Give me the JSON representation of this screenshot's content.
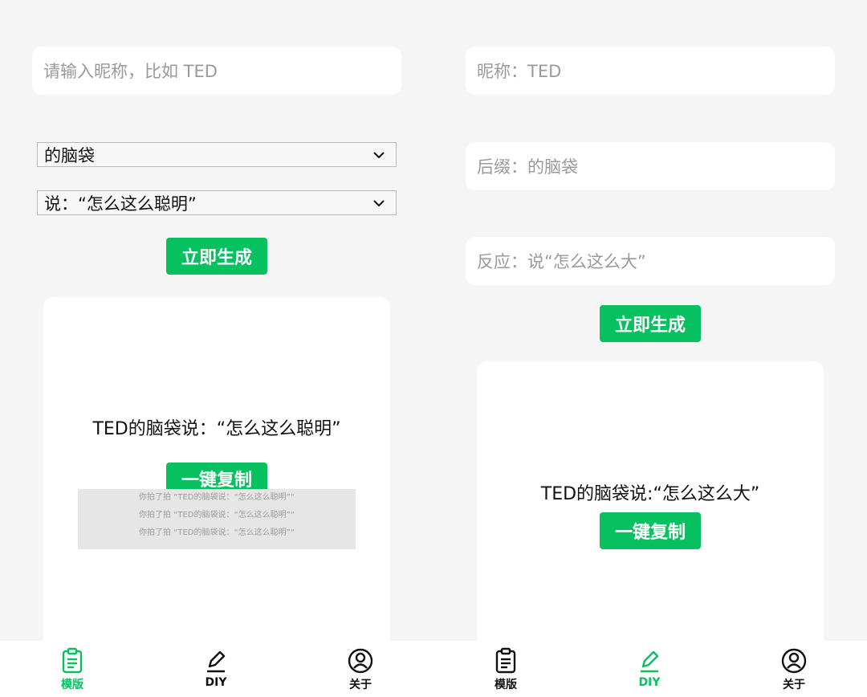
{
  "template_panel": {
    "nickname_placeholder": "请输入昵称，比如 TED",
    "suffix_selected": "的脑袋",
    "reaction_selected": "说：“怎么这么聪明”",
    "generate_label": "立即生成",
    "result_text": "TED的脑袋说：“怎么这么聪明”",
    "copy_label": "一键复制",
    "tip_lines": [
      "你拍了拍 “TED的脑袋说：“怎么这么聪明”“",
      "你拍了拍 “TED的脑袋说：“怎么这么聪明”“",
      "你拍了拍 “TED的脑袋说：“怎么这么聪明”“"
    ]
  },
  "diy_panel": {
    "nickname_value": "昵称：TED",
    "suffix_value": "后缀：的脑袋",
    "reaction_value": "反应：说“怎么这么大”",
    "generate_label": "立即生成",
    "result_text": "TED的脑袋说:“怎么这么大”",
    "copy_label": "一键复制"
  },
  "tabbar": {
    "left": [
      {
        "label": "模版",
        "icon": "clipboard-icon",
        "active": true
      },
      {
        "label": "DIY",
        "icon": "pencil-icon",
        "active": false
      },
      {
        "label": "关于",
        "icon": "user-circle-icon",
        "active": false
      }
    ],
    "right": [
      {
        "label": "模版",
        "icon": "clipboard-icon",
        "active": false
      },
      {
        "label": "DIY",
        "icon": "pencil-icon",
        "active": true
      },
      {
        "label": "关于",
        "icon": "user-circle-icon",
        "active": false
      }
    ]
  },
  "colors": {
    "accent": "#07c160",
    "background": "#f5f5f5",
    "card": "#ffffff",
    "tip_bg": "#e6e6e6"
  }
}
